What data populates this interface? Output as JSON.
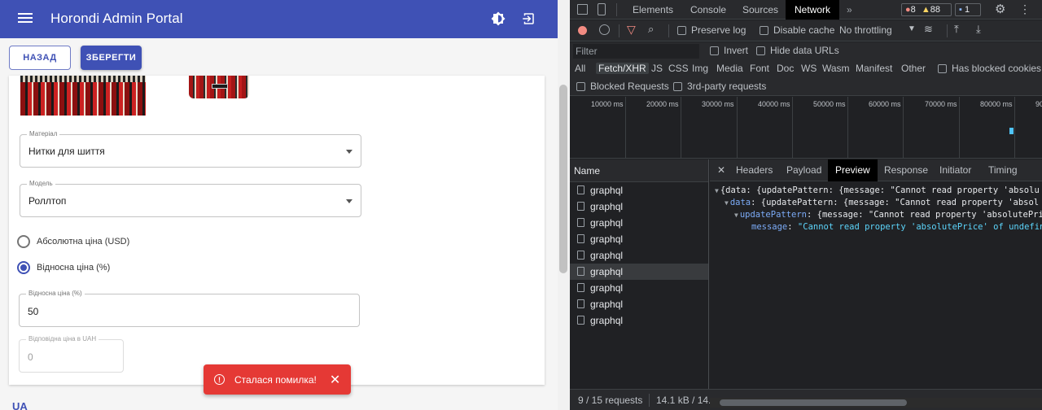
{
  "app": {
    "title": "Horondi Admin Portal",
    "back_label": "НАЗАД",
    "save_label": "ЗБЕРЕГТИ",
    "material": {
      "label": "Матеріал",
      "value": "Нитки для шиття"
    },
    "model": {
      "label": "Модель",
      "value": "Роллтоп"
    },
    "radio_absolute": "Абсолютна ціна (USD)",
    "radio_relative": "Відносна ціна (%)",
    "relative_price": {
      "label": "Відносна ціна (%)",
      "value": "50"
    },
    "uah_price": {
      "label": "Відповідна ціна в UAH",
      "value": "0"
    },
    "snackbar": "Сталася помилка!",
    "section_title": "UA",
    "colors": {
      "primary": "#3f51b5",
      "error": "#e53935"
    }
  },
  "devtools": {
    "tabs": [
      "Elements",
      "Console",
      "Sources",
      "Network"
    ],
    "active_tab": "Network",
    "errors": "8",
    "warnings": "88",
    "messages": "1",
    "preserve_log": "Preserve log",
    "disable_cache": "Disable cache",
    "throttling": "No throttling",
    "filter_placeholder": "Filter",
    "invert": "Invert",
    "hide_data_urls": "Hide data URLs",
    "types": [
      "All",
      "Fetch/XHR",
      "JS",
      "CSS",
      "Img",
      "Media",
      "Font",
      "Doc",
      "WS",
      "Wasm",
      "Manifest",
      "Other"
    ],
    "has_blocked_cookies": "Has blocked cookies",
    "blocked_requests": "Blocked Requests",
    "third_party": "3rd-party requests",
    "timeline_ticks": [
      "10000 ms",
      "20000 ms",
      "30000 ms",
      "40000 ms",
      "50000 ms",
      "60000 ms",
      "70000 ms",
      "80000 ms",
      "90"
    ],
    "name_header": "Name",
    "requests": [
      "graphql",
      "graphql",
      "graphql",
      "graphql",
      "graphql",
      "graphql",
      "graphql",
      "graphql",
      "graphql"
    ],
    "detail_tabs": [
      "Headers",
      "Payload",
      "Preview",
      "Response",
      "Initiator",
      "Timing"
    ],
    "active_detail_tab": "Preview",
    "preview": {
      "line1": "{data: {updatePattern: {message: \"Cannot read property 'absolu",
      "line2_key": "data",
      "line2": ": {updatePattern: {message: \"Cannot read property 'absol",
      "line3_key": "updatePattern",
      "line3": ": {message: \"Cannot read property 'absolutePri",
      "line4_key": "message",
      "line4": "\"Cannot read property 'absolutePrice' of undefin"
    },
    "status_requests": "9 / 15 requests",
    "status_size": "14.1 kB / 14."
  }
}
